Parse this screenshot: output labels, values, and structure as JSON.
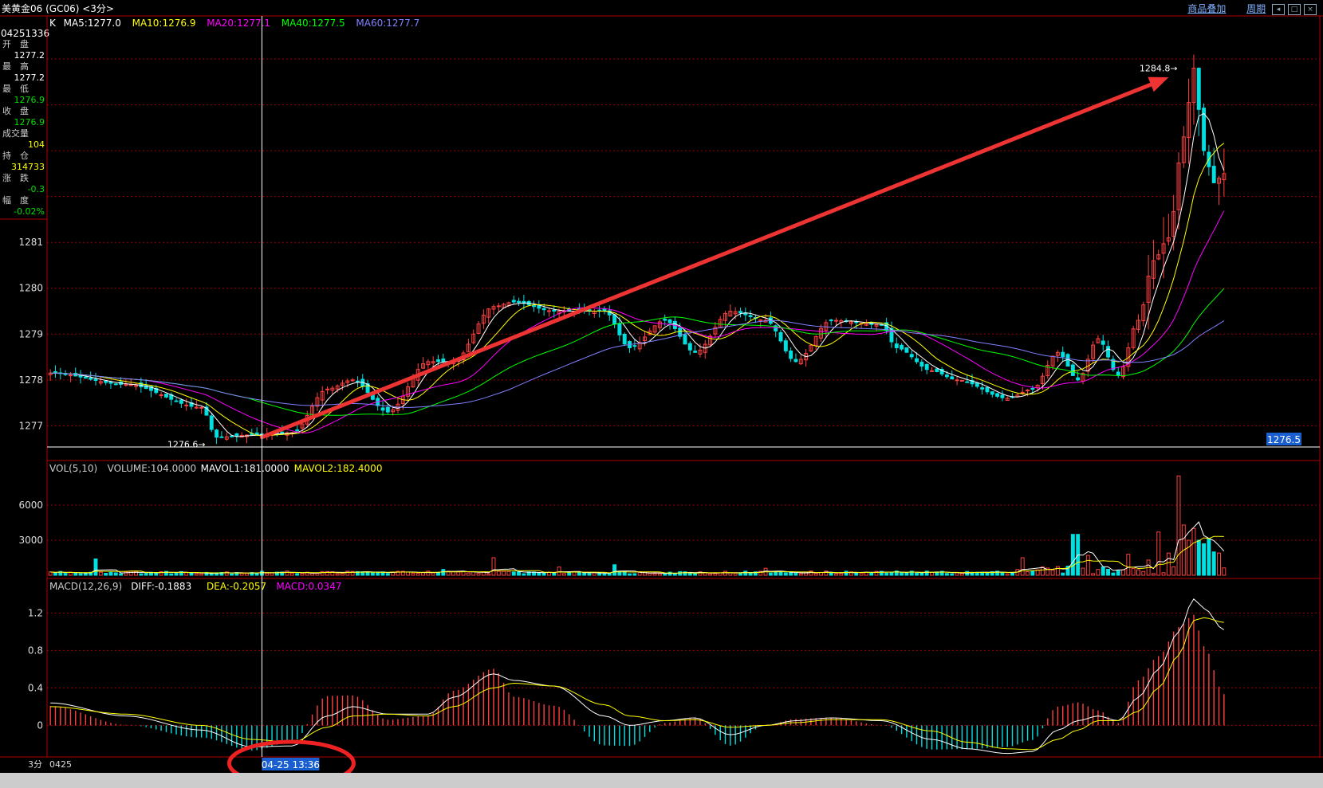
{
  "window": {
    "title": "美黄金06 (GC06) <3分>",
    "buttons": [
      "商品叠加",
      "周期"
    ]
  },
  "info_panel": {
    "code": "04251336",
    "rows": [
      {
        "label": "开　盘",
        "value": "1277.2",
        "color": "white"
      },
      {
        "label": "最　高",
        "value": "1277.2",
        "color": "white"
      },
      {
        "label": "最　低",
        "value": "1276.9",
        "color": "green"
      },
      {
        "label": "收　盘",
        "value": "1276.9",
        "color": "green"
      },
      {
        "label": "成交量",
        "value": "104",
        "color": "yellow"
      },
      {
        "label": "持　仓",
        "value": "314733",
        "color": "yellow"
      },
      {
        "label": "涨　跌",
        "value": "-0.3",
        "color": "green"
      },
      {
        "label": "幅　度",
        "value": "-0.02%",
        "color": "green"
      }
    ]
  },
  "chart_data": [
    {
      "type": "candlestick",
      "panel": "price",
      "legend": [
        {
          "text": "K",
          "color": "#ffffff"
        },
        {
          "text": "MA5:1277.0",
          "color": "#ffffff"
        },
        {
          "text": "MA10:1276.9",
          "color": "#ffff00"
        },
        {
          "text": "MA20:1277.1",
          "color": "#ff00ff"
        },
        {
          "text": "MA40:1277.5",
          "color": "#00ff00"
        },
        {
          "text": "MA60:1277.7",
          "color": "#8080ff"
        }
      ],
      "y_ticks": [
        1277,
        1278,
        1279,
        1280,
        1281
      ],
      "ylim": [
        1276.45,
        1285.8
      ],
      "bar_count": 234,
      "anchors": [
        {
          "i": 0,
          "v": 1278.15
        },
        {
          "i": 15,
          "v": 1277.9
        },
        {
          "i": 30,
          "v": 1277.4
        },
        {
          "i": 33,
          "v": 1276.75
        },
        {
          "i": 40,
          "v": 1276.8
        },
        {
          "i": 48,
          "v": 1276.85
        },
        {
          "i": 55,
          "v": 1277.8
        },
        {
          "i": 60,
          "v": 1278.0
        },
        {
          "i": 67,
          "v": 1277.3
        },
        {
          "i": 75,
          "v": 1278.4
        },
        {
          "i": 80,
          "v": 1278.4
        },
        {
          "i": 88,
          "v": 1279.6
        },
        {
          "i": 92,
          "v": 1279.7
        },
        {
          "i": 100,
          "v": 1279.5
        },
        {
          "i": 110,
          "v": 1279.5
        },
        {
          "i": 115,
          "v": 1278.7
        },
        {
          "i": 122,
          "v": 1279.3
        },
        {
          "i": 128,
          "v": 1278.6
        },
        {
          "i": 135,
          "v": 1279.5
        },
        {
          "i": 142,
          "v": 1279.3
        },
        {
          "i": 148,
          "v": 1278.4
        },
        {
          "i": 155,
          "v": 1279.3
        },
        {
          "i": 165,
          "v": 1279.2
        },
        {
          "i": 168,
          "v": 1278.7
        },
        {
          "i": 175,
          "v": 1278.2
        },
        {
          "i": 180,
          "v": 1278.0
        },
        {
          "i": 190,
          "v": 1277.6
        },
        {
          "i": 195,
          "v": 1277.8
        },
        {
          "i": 200,
          "v": 1278.6
        },
        {
          "i": 204,
          "v": 1278.0
        },
        {
          "i": 208,
          "v": 1278.9
        },
        {
          "i": 212,
          "v": 1278.1
        },
        {
          "i": 216,
          "v": 1279.3
        },
        {
          "i": 219,
          "v": 1280.6
        },
        {
          "i": 222,
          "v": 1281.1
        },
        {
          "i": 225,
          "v": 1283.3
        },
        {
          "i": 227,
          "v": 1284.8
        },
        {
          "i": 229,
          "v": 1283.0
        },
        {
          "i": 231,
          "v": 1282.3
        },
        {
          "i": 233,
          "v": 1282.5
        }
      ],
      "annotations": [
        {
          "text": "1284.8",
          "at_bar": 226,
          "value": 1284.8
        },
        {
          "text": "1276.6",
          "at_bar": 33,
          "value": 1276.6
        }
      ],
      "last_price": "1276.5",
      "trend_arrows": [
        {
          "from": {
            "i": 42,
            "v": 1276.75
          },
          "to": {
            "i": 222,
            "v": 1284.6
          },
          "color": "#ee3333"
        }
      ]
    },
    {
      "type": "bar",
      "panel": "volume",
      "legend": [
        {
          "text": "VOL(5,10)",
          "color": "#cccccc"
        },
        {
          "text": "VOLUME:104.0000",
          "color": "#cccccc"
        },
        {
          "text": "MAVOL1:181.0000",
          "color": "#ffffff"
        },
        {
          "text": "MAVOL2:182.4000",
          "color": "#ffff00"
        }
      ],
      "y_ticks": [
        3000,
        6000
      ],
      "ylim": [
        0,
        9000
      ],
      "spikes": [
        {
          "i": 9,
          "v": 1400
        },
        {
          "i": 78,
          "v": 500
        },
        {
          "i": 88,
          "v": 1500
        },
        {
          "i": 101,
          "v": 700
        },
        {
          "i": 112,
          "v": 900
        },
        {
          "i": 142,
          "v": 600
        },
        {
          "i": 193,
          "v": 1500
        },
        {
          "i": 203,
          "v": 3500
        },
        {
          "i": 204,
          "v": 3500
        },
        {
          "i": 206,
          "v": 1700
        },
        {
          "i": 214,
          "v": 1800
        },
        {
          "i": 218,
          "v": 1300
        },
        {
          "i": 220,
          "v": 3700
        },
        {
          "i": 222,
          "v": 1900
        },
        {
          "i": 224,
          "v": 8500
        },
        {
          "i": 225,
          "v": 4300
        },
        {
          "i": 226,
          "v": 3000
        },
        {
          "i": 227,
          "v": 4000
        },
        {
          "i": 228,
          "v": 3000
        },
        {
          "i": 229,
          "v": 2700
        },
        {
          "i": 230,
          "v": 3100
        },
        {
          "i": 231,
          "v": 2000
        },
        {
          "i": 232,
          "v": 1900
        }
      ]
    },
    {
      "type": "bar",
      "panel": "macd",
      "legend": [
        {
          "text": "MACD(12,26,9)",
          "color": "#cccccc"
        },
        {
          "text": "DIFF:-0.1883",
          "color": "#ffffff"
        },
        {
          "text": "DEA:-0.2057",
          "color": "#ffff00"
        },
        {
          "text": "MACD:0.0347",
          "color": "#ff00ff"
        }
      ],
      "y_ticks": [
        0,
        0.4,
        0.8,
        1.2
      ],
      "ylim": [
        -0.32,
        1.45
      ],
      "diff_anchors": [
        {
          "i": 0,
          "v": 0.24
        },
        {
          "i": 15,
          "v": 0.1
        },
        {
          "i": 30,
          "v": -0.05
        },
        {
          "i": 40,
          "v": -0.23
        },
        {
          "i": 48,
          "v": -0.22
        },
        {
          "i": 55,
          "v": 0.1
        },
        {
          "i": 60,
          "v": 0.2
        },
        {
          "i": 67,
          "v": 0.12
        },
        {
          "i": 75,
          "v": 0.12
        },
        {
          "i": 80,
          "v": 0.3
        },
        {
          "i": 88,
          "v": 0.55
        },
        {
          "i": 92,
          "v": 0.48
        },
        {
          "i": 100,
          "v": 0.42
        },
        {
          "i": 110,
          "v": 0.1
        },
        {
          "i": 115,
          "v": 0.0
        },
        {
          "i": 122,
          "v": 0.05
        },
        {
          "i": 128,
          "v": 0.08
        },
        {
          "i": 135,
          "v": -0.1
        },
        {
          "i": 142,
          "v": 0.0
        },
        {
          "i": 148,
          "v": 0.05
        },
        {
          "i": 155,
          "v": 0.08
        },
        {
          "i": 165,
          "v": 0.05
        },
        {
          "i": 175,
          "v": -0.15
        },
        {
          "i": 182,
          "v": -0.25
        },
        {
          "i": 190,
          "v": -0.3
        },
        {
          "i": 195,
          "v": -0.28
        },
        {
          "i": 200,
          "v": -0.05
        },
        {
          "i": 204,
          "v": 0.05
        },
        {
          "i": 208,
          "v": 0.1
        },
        {
          "i": 212,
          "v": 0.05
        },
        {
          "i": 216,
          "v": 0.3
        },
        {
          "i": 220,
          "v": 0.6
        },
        {
          "i": 224,
          "v": 1.0
        },
        {
          "i": 227,
          "v": 1.35
        },
        {
          "i": 229,
          "v": 1.25
        },
        {
          "i": 233,
          "v": 1.02
        }
      ],
      "dea_anchors": [
        {
          "i": 0,
          "v": 0.2
        },
        {
          "i": 15,
          "v": 0.12
        },
        {
          "i": 30,
          "v": 0.0
        },
        {
          "i": 40,
          "v": -0.15
        },
        {
          "i": 48,
          "v": -0.18
        },
        {
          "i": 55,
          "v": -0.02
        },
        {
          "i": 60,
          "v": 0.1
        },
        {
          "i": 67,
          "v": 0.12
        },
        {
          "i": 75,
          "v": 0.1
        },
        {
          "i": 80,
          "v": 0.2
        },
        {
          "i": 88,
          "v": 0.4
        },
        {
          "i": 92,
          "v": 0.45
        },
        {
          "i": 100,
          "v": 0.42
        },
        {
          "i": 110,
          "v": 0.22
        },
        {
          "i": 115,
          "v": 0.1
        },
        {
          "i": 122,
          "v": 0.05
        },
        {
          "i": 128,
          "v": 0.06
        },
        {
          "i": 135,
          "v": -0.02
        },
        {
          "i": 142,
          "v": 0.0
        },
        {
          "i": 148,
          "v": 0.03
        },
        {
          "i": 155,
          "v": 0.06
        },
        {
          "i": 165,
          "v": 0.06
        },
        {
          "i": 175,
          "v": -0.06
        },
        {
          "i": 182,
          "v": -0.18
        },
        {
          "i": 190,
          "v": -0.25
        },
        {
          "i": 195,
          "v": -0.26
        },
        {
          "i": 200,
          "v": -0.15
        },
        {
          "i": 204,
          "v": -0.05
        },
        {
          "i": 208,
          "v": 0.05
        },
        {
          "i": 212,
          "v": 0.05
        },
        {
          "i": 216,
          "v": 0.15
        },
        {
          "i": 220,
          "v": 0.4
        },
        {
          "i": 224,
          "v": 0.75
        },
        {
          "i": 227,
          "v": 1.12
        },
        {
          "i": 229,
          "v": 1.15
        },
        {
          "i": 233,
          "v": 1.1
        }
      ]
    }
  ],
  "cursor": {
    "bar_index": 42,
    "time_label": "04-25 13:36"
  },
  "bottom_axis": {
    "period_label": "3分",
    "date_label": "0425"
  },
  "colors": {
    "up": "#ff4040",
    "down": "#00e0e0",
    "grid": "#990000",
    "border": "#b00000",
    "arrow": "#ee3333",
    "circle": "#ee2222"
  }
}
